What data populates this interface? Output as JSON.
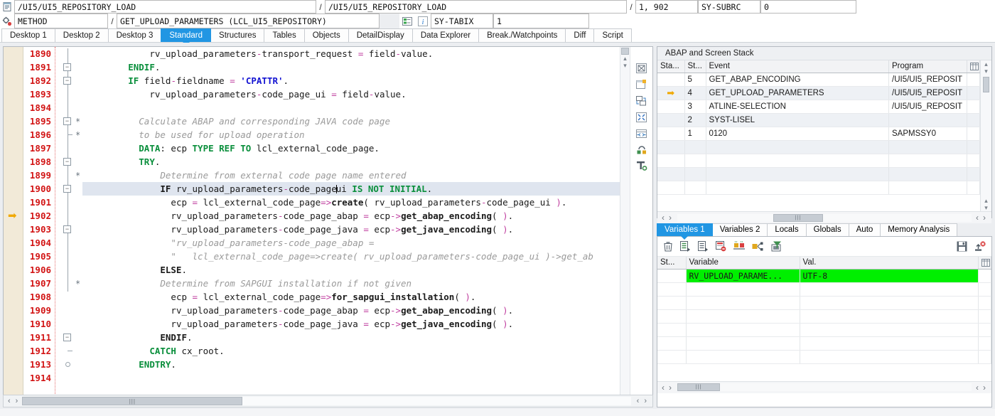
{
  "header": {
    "program_icon": "program-icon",
    "method_icon": "method-icon",
    "program_field_1": "/UI5/UI5_REPOSITORY_LOAD",
    "program_field_2": "/UI5/UI5_REPOSITORY_LOAD",
    "line_number": "1, 902",
    "sy_subrc_label": "SY-SUBRC",
    "sy_subrc_value": "0",
    "event_type": "METHOD",
    "event_name": "GET_UPLOAD_PARAMETERS (LCL_UI5_REPOSITORY)",
    "sy_tabix_label": "SY-TABIX",
    "sy_tabix_value": "1",
    "separator": "/",
    "stack_button_icon": "stack-detail-icon",
    "info_button_icon": "info-icon"
  },
  "tabs": [
    {
      "label": "Desktop 1",
      "active": false
    },
    {
      "label": "Desktop 2",
      "active": false
    },
    {
      "label": "Desktop 3",
      "active": false
    },
    {
      "label": "Standard",
      "active": true
    },
    {
      "label": "Structures",
      "active": false
    },
    {
      "label": "Tables",
      "active": false
    },
    {
      "label": "Objects",
      "active": false
    },
    {
      "label": "DetailDisplay",
      "active": false
    },
    {
      "label": "Data Explorer",
      "active": false
    },
    {
      "label": "Break./Watchpoints",
      "active": false
    },
    {
      "label": "Diff",
      "active": false
    },
    {
      "label": "Script",
      "active": false
    }
  ],
  "editor": {
    "current_line": 1902,
    "highlight_line": 1900,
    "lines": [
      {
        "no": "1890",
        "indent": 12,
        "tokens": [
          {
            "t": "rv_upload_parameters",
            "c": "plain"
          },
          {
            "t": "-",
            "c": "op"
          },
          {
            "t": "transport_request ",
            "c": "plain"
          },
          {
            "t": "= ",
            "c": "op"
          },
          {
            "t": "field",
            "c": "plain"
          },
          {
            "t": "-",
            "c": "op"
          },
          {
            "t": "value",
            "c": "plain"
          },
          {
            "t": ".",
            "c": "plain"
          }
        ]
      },
      {
        "no": "1891",
        "indent": 8,
        "tokens": [
          {
            "t": "ENDIF",
            "c": "kw"
          },
          {
            "t": ".",
            "c": "plain"
          }
        ]
      },
      {
        "no": "1892",
        "indent": 8,
        "tokens": [
          {
            "t": "IF ",
            "c": "kw"
          },
          {
            "t": "field",
            "c": "plain"
          },
          {
            "t": "-",
            "c": "op"
          },
          {
            "t": "fieldname ",
            "c": "plain"
          },
          {
            "t": "= ",
            "c": "op"
          },
          {
            "t": "'CPATTR'",
            "c": "lit"
          },
          {
            "t": ".",
            "c": "plain"
          }
        ]
      },
      {
        "no": "1893",
        "indent": 12,
        "tokens": [
          {
            "t": "rv_upload_parameters",
            "c": "plain"
          },
          {
            "t": "-",
            "c": "op"
          },
          {
            "t": "code_page_ui ",
            "c": "plain"
          },
          {
            "t": "= ",
            "c": "op"
          },
          {
            "t": "field",
            "c": "plain"
          },
          {
            "t": "-",
            "c": "op"
          },
          {
            "t": "value",
            "c": "plain"
          },
          {
            "t": ".",
            "c": "plain"
          }
        ]
      },
      {
        "no": "1894",
        "indent": 0,
        "tokens": []
      },
      {
        "no": "1895",
        "indent": 10,
        "tokens": [
          {
            "t": "Calculate ABAP and corresponding JAVA code page",
            "c": "cmt"
          }
        ]
      },
      {
        "no": "1896",
        "indent": 10,
        "tokens": [
          {
            "t": "to be used for upload operation",
            "c": "cmt"
          }
        ]
      },
      {
        "no": "1897",
        "indent": 10,
        "tokens": [
          {
            "t": "DATA",
            "c": "kw"
          },
          {
            "t": ": ecp ",
            "c": "plain"
          },
          {
            "t": "TYPE REF TO ",
            "c": "kw"
          },
          {
            "t": "lcl_external_code_page",
            "c": "plain"
          },
          {
            "t": ".",
            "c": "plain"
          }
        ]
      },
      {
        "no": "1898",
        "indent": 10,
        "tokens": [
          {
            "t": "TRY",
            "c": "kw"
          },
          {
            "t": ".",
            "c": "plain"
          }
        ]
      },
      {
        "no": "1899",
        "indent": 14,
        "tokens": [
          {
            "t": "Determine from external code page name entered",
            "c": "cmt"
          }
        ]
      },
      {
        "no": "1900",
        "indent": 14,
        "tokens": [
          {
            "t": "IF ",
            "c": "kwb"
          },
          {
            "t": "rv_upload_parameters",
            "c": "plain"
          },
          {
            "t": "-",
            "c": "op"
          },
          {
            "t": "code_page",
            "c": "plain"
          },
          {
            "t": "|CARET|",
            "c": "caret"
          },
          {
            "t": "ui ",
            "c": "plain"
          },
          {
            "t": "IS NOT INITIAL",
            "c": "kw"
          },
          {
            "t": ".",
            "c": "plain"
          }
        ]
      },
      {
        "no": "1901",
        "indent": 16,
        "tokens": [
          {
            "t": "ecp ",
            "c": "plain"
          },
          {
            "t": "= ",
            "c": "op"
          },
          {
            "t": "lcl_external_code_page",
            "c": "plain"
          },
          {
            "t": "=>",
            "c": "op"
          },
          {
            "t": "create",
            "c": "kwb"
          },
          {
            "t": "( rv_upload_parameters",
            "c": "plain"
          },
          {
            "t": "-",
            "c": "op"
          },
          {
            "t": "code_page_ui ",
            "c": "plain"
          },
          {
            "t": ")",
            "c": "op"
          },
          {
            "t": ".",
            "c": "plain"
          }
        ]
      },
      {
        "no": "1902",
        "indent": 16,
        "tokens": [
          {
            "t": "rv_upload_parameters",
            "c": "plain"
          },
          {
            "t": "-",
            "c": "op"
          },
          {
            "t": "code_page_abap ",
            "c": "plain"
          },
          {
            "t": "= ",
            "c": "op"
          },
          {
            "t": "ecp",
            "c": "plain"
          },
          {
            "t": "->",
            "c": "op"
          },
          {
            "t": "get_abap_encoding",
            "c": "kwb"
          },
          {
            "t": "( ",
            "c": "plain"
          },
          {
            "t": ")",
            "c": "op"
          },
          {
            "t": ".",
            "c": "plain"
          }
        ]
      },
      {
        "no": "1903",
        "indent": 16,
        "tokens": [
          {
            "t": "rv_upload_parameters",
            "c": "plain"
          },
          {
            "t": "-",
            "c": "op"
          },
          {
            "t": "code_page_java ",
            "c": "plain"
          },
          {
            "t": "= ",
            "c": "op"
          },
          {
            "t": "ecp",
            "c": "plain"
          },
          {
            "t": "->",
            "c": "op"
          },
          {
            "t": "get_java_encoding",
            "c": "kwb"
          },
          {
            "t": "( ",
            "c": "plain"
          },
          {
            "t": ")",
            "c": "op"
          },
          {
            "t": ".",
            "c": "plain"
          }
        ]
      },
      {
        "no": "1904",
        "indent": 16,
        "tokens": [
          {
            "t": "\"rv_upload_parameters-code_page_abap =",
            "c": "cmt"
          }
        ]
      },
      {
        "no": "1905",
        "indent": 16,
        "tokens": [
          {
            "t": "\"   lcl_external_code_page=>create( rv_upload_parameters-code_page_ui )->get_ab",
            "c": "cmt"
          }
        ]
      },
      {
        "no": "1906",
        "indent": 14,
        "tokens": [
          {
            "t": "ELSE",
            "c": "kwb"
          },
          {
            "t": ".",
            "c": "plain"
          }
        ]
      },
      {
        "no": "1907",
        "indent": 14,
        "tokens": [
          {
            "t": "Determine from SAPGUI installation if not given",
            "c": "cmt"
          }
        ]
      },
      {
        "no": "1908",
        "indent": 16,
        "tokens": [
          {
            "t": "ecp ",
            "c": "plain"
          },
          {
            "t": "= ",
            "c": "op"
          },
          {
            "t": "lcl_external_code_page",
            "c": "plain"
          },
          {
            "t": "=>",
            "c": "op"
          },
          {
            "t": "for_sapgui_installation",
            "c": "kwb"
          },
          {
            "t": "( ",
            "c": "plain"
          },
          {
            "t": ")",
            "c": "op"
          },
          {
            "t": ".",
            "c": "plain"
          }
        ]
      },
      {
        "no": "1909",
        "indent": 16,
        "tokens": [
          {
            "t": "rv_upload_parameters",
            "c": "plain"
          },
          {
            "t": "-",
            "c": "op"
          },
          {
            "t": "code_page_abap ",
            "c": "plain"
          },
          {
            "t": "= ",
            "c": "op"
          },
          {
            "t": "ecp",
            "c": "plain"
          },
          {
            "t": "->",
            "c": "op"
          },
          {
            "t": "get_abap_encoding",
            "c": "kwb"
          },
          {
            "t": "( ",
            "c": "plain"
          },
          {
            "t": ")",
            "c": "op"
          },
          {
            "t": ".",
            "c": "plain"
          }
        ]
      },
      {
        "no": "1910",
        "indent": 16,
        "tokens": [
          {
            "t": "rv_upload_parameters",
            "c": "plain"
          },
          {
            "t": "-",
            "c": "op"
          },
          {
            "t": "code_page_java ",
            "c": "plain"
          },
          {
            "t": "= ",
            "c": "op"
          },
          {
            "t": "ecp",
            "c": "plain"
          },
          {
            "t": "->",
            "c": "op"
          },
          {
            "t": "get_java_encoding",
            "c": "kwb"
          },
          {
            "t": "( ",
            "c": "plain"
          },
          {
            "t": ")",
            "c": "op"
          },
          {
            "t": ".",
            "c": "plain"
          }
        ]
      },
      {
        "no": "1911",
        "indent": 14,
        "tokens": [
          {
            "t": "ENDIF",
            "c": "kwb"
          },
          {
            "t": ".",
            "c": "plain"
          }
        ]
      },
      {
        "no": "1912",
        "indent": 12,
        "tokens": [
          {
            "t": "CATCH ",
            "c": "kw"
          },
          {
            "t": "cx_root",
            "c": "plain"
          },
          {
            "t": ".",
            "c": "plain"
          }
        ]
      },
      {
        "no": "1913",
        "indent": 10,
        "tokens": [
          {
            "t": "ENDTRY",
            "c": "kw"
          },
          {
            "t": ".",
            "c": "plain"
          }
        ]
      },
      {
        "no": "1914",
        "indent": 0,
        "tokens": []
      }
    ],
    "rail_icons": [
      "layout-icon",
      "new-window-icon",
      "exchange-icon",
      "fullscreen-icon",
      "resize-icon",
      "lock-icon",
      "settings-tools-icon"
    ],
    "hscroll": {
      "left_arrow": "‹",
      "right_arrow": "›"
    }
  },
  "stack_panel": {
    "title": "ABAP and Screen Stack",
    "grid_icon": "grid-config-icon",
    "columns": [
      "Sta...",
      "St...",
      "Event",
      "Program"
    ],
    "rows": [
      {
        "marker": "",
        "st": "5",
        "event": "GET_ABAP_ENCODING",
        "program": "/UI5/UI5_REPOSIT",
        "green": true
      },
      {
        "marker": "current-position-arrow",
        "st": "4",
        "event": "GET_UPLOAD_PARAMETERS",
        "program": "/UI5/UI5_REPOSIT",
        "green": true
      },
      {
        "marker": "",
        "st": "3",
        "event": "ATLINE-SELECTION",
        "program": "/UI5/UI5_REPOSIT",
        "green": true
      },
      {
        "marker": "",
        "st": "2",
        "event": "SYST-LISEL",
        "program": "",
        "green": false
      },
      {
        "marker": "",
        "st": "1",
        "event": "0120",
        "program": "SAPMSSY0",
        "green": false
      },
      {
        "marker": "",
        "st": "",
        "event": "",
        "program": "",
        "green": false
      },
      {
        "marker": "",
        "st": "",
        "event": "",
        "program": "",
        "green": false
      },
      {
        "marker": "",
        "st": "",
        "event": "",
        "program": "",
        "green": false
      },
      {
        "marker": "",
        "st": "",
        "event": "",
        "program": "",
        "green": false
      }
    ]
  },
  "variables_panel": {
    "tabs": [
      {
        "label": "Variables 1",
        "active": true
      },
      {
        "label": "Variables 2",
        "active": false
      },
      {
        "label": "Locals",
        "active": false
      },
      {
        "label": "Globals",
        "active": false
      },
      {
        "label": "Auto",
        "active": false
      },
      {
        "label": "Memory Analysis",
        "active": false
      }
    ],
    "toolbar_icons": [
      "delete-icon",
      "insert-row-icon",
      "insert-row-below-icon",
      "delete-row-icon",
      "compare-icon",
      "structure-icon",
      "filter-icon"
    ],
    "toolbar_right_icons": [
      "save-icon",
      "close-variable-icon"
    ],
    "grid_icon": "grid-config-icon",
    "columns": [
      "St...",
      "Variable",
      "Val."
    ],
    "rows": [
      {
        "st": "",
        "variable": "RV_UPLOAD_PARAME...",
        "value": "UTF-8",
        "highlight": true
      },
      {
        "st": "",
        "variable": "",
        "value": "",
        "highlight": false
      },
      {
        "st": "",
        "variable": "",
        "value": "",
        "highlight": false
      },
      {
        "st": "",
        "variable": "",
        "value": "",
        "highlight": false
      },
      {
        "st": "",
        "variable": "",
        "value": "",
        "highlight": false
      },
      {
        "st": "",
        "variable": "",
        "value": "",
        "highlight": false
      },
      {
        "st": "",
        "variable": "",
        "value": "",
        "highlight": false
      }
    ],
    "hscroll": {
      "left_arrow": "‹",
      "right_arrow": "›"
    }
  },
  "colors": {
    "accent": "#2196e3",
    "keyword": "#0a8f3c",
    "literal": "#1414d2",
    "comment": "#9a9a9a",
    "operator": "#c040a0",
    "line_number": "#d21414",
    "highlight_green": "#00ef00",
    "stack_green": "#2faa46",
    "arrow_orange": "#f0a800"
  }
}
